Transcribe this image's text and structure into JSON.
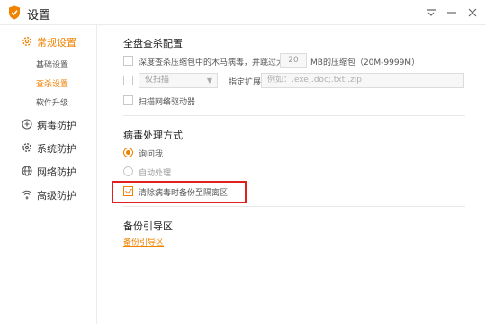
{
  "window": {
    "title": "设置",
    "accent_color": "#f08200",
    "controls": [
      "pin-icon",
      "minimize-icon",
      "close-icon"
    ]
  },
  "sidebar": {
    "items": [
      {
        "label": "常规设置",
        "icon": "gear-icon",
        "active": true,
        "subitems": [
          {
            "label": "基础设置",
            "active": false
          },
          {
            "label": "查杀设置",
            "active": true
          },
          {
            "label": "软件升级",
            "active": false
          }
        ]
      },
      {
        "label": "病毒防护",
        "icon": "virus-shield-icon",
        "active": false
      },
      {
        "label": "系统防护",
        "icon": "system-gear-icon",
        "active": false
      },
      {
        "label": "网络防护",
        "icon": "globe-icon",
        "active": false
      },
      {
        "label": "高级防护",
        "icon": "wifi-shield-icon",
        "active": false
      }
    ]
  },
  "scan_config": {
    "title": "全盘查杀配置",
    "archive_option": {
      "checked": false,
      "label_before": "深度查杀压缩包中的木马病毒，并跳过大于",
      "size_value": "20",
      "label_after": "MB的压缩包（20M-9999M）"
    },
    "scan_mode_option": {
      "checked": false,
      "select_value": "仅扫描",
      "label": "指定扩展名文件",
      "placeholder": "例如：.exe;.doc;.txt;.zip"
    },
    "network_drive_option": {
      "checked": false,
      "label": "扫描网络驱动器"
    }
  },
  "virus_handling": {
    "title": "病毒处理方式",
    "options": [
      {
        "label": "询问我",
        "selected": true
      },
      {
        "label": "自动处理",
        "selected": false
      }
    ],
    "backup_option": {
      "checked": true,
      "label": "清除病毒时备份至隔离区"
    }
  },
  "backup_guide": {
    "title": "备份引导区",
    "link_label": "备份引导区"
  }
}
